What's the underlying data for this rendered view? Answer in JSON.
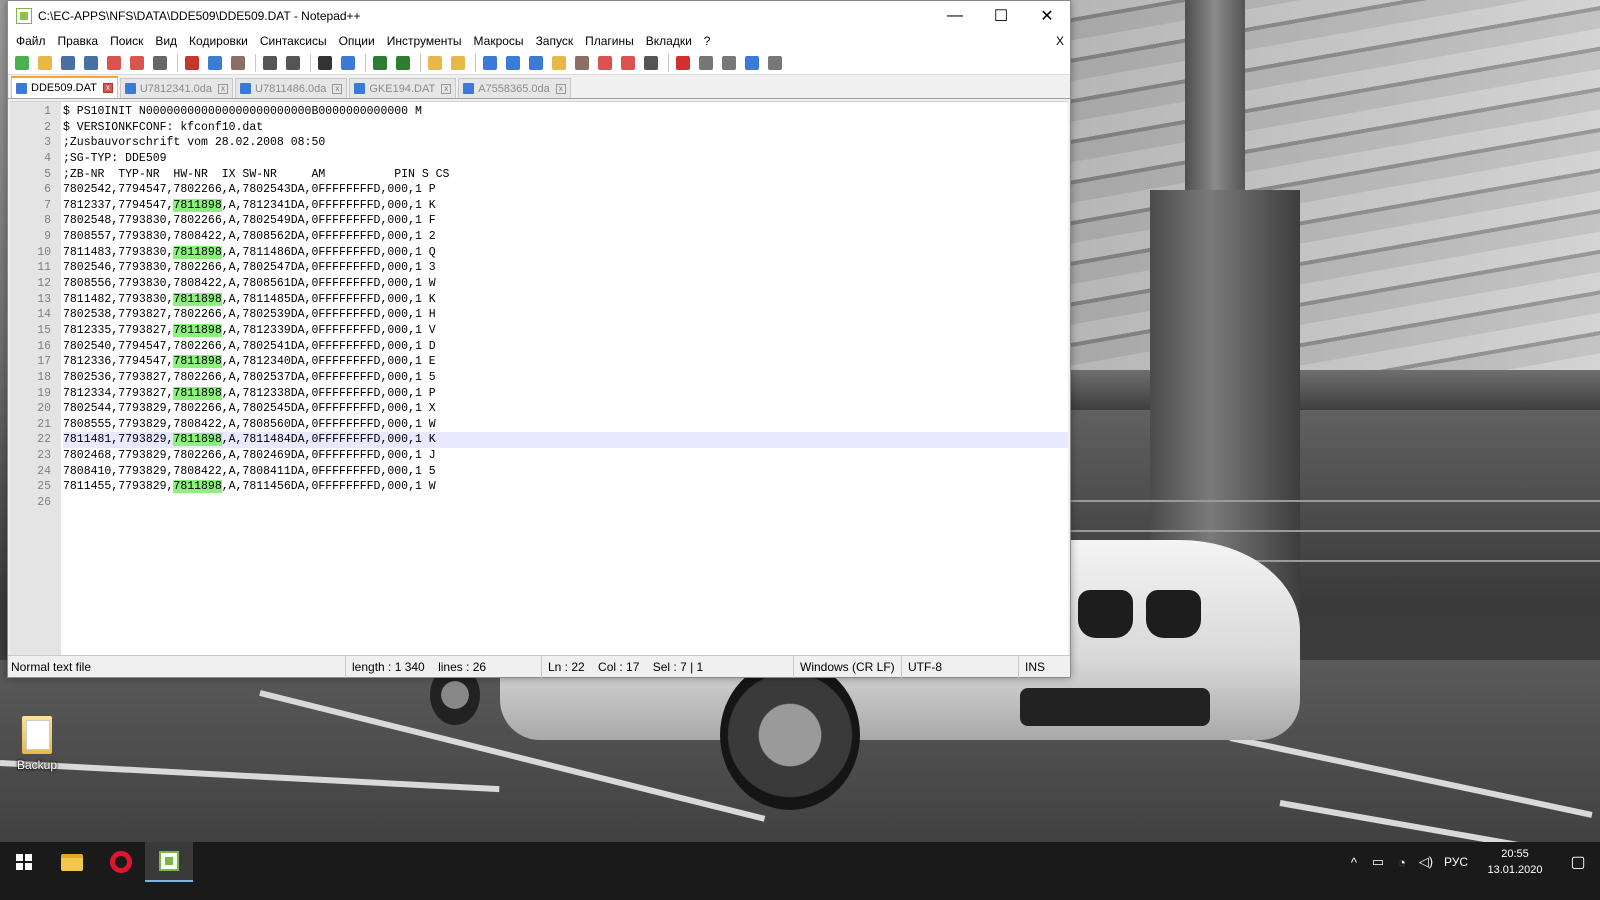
{
  "window": {
    "title": "C:\\EC-APPS\\NFS\\DATA\\DDE509\\DDE509.DAT - Notepad++",
    "minimize_glyph": "—",
    "maximize_glyph": "☐",
    "close_glyph": "✕"
  },
  "menu": [
    "Файл",
    "Правка",
    "Поиск",
    "Вид",
    "Кодировки",
    "Синтаксисы",
    "Опции",
    "Инструменты",
    "Макросы",
    "Запуск",
    "Плагины",
    "Вкладки",
    "?"
  ],
  "menu_close": "X",
  "toolbar": [
    {
      "name": "new-file-icon",
      "color": "#4caf50"
    },
    {
      "name": "open-file-icon",
      "color": "#e6b84a"
    },
    {
      "name": "save-icon",
      "color": "#4a6fa5"
    },
    {
      "name": "save-all-icon",
      "color": "#4a6fa5"
    },
    {
      "name": "close-file-icon",
      "color": "#d9534f"
    },
    {
      "name": "close-all-icon",
      "color": "#d9534f"
    },
    {
      "name": "print-icon",
      "color": "#666666"
    },
    {
      "name": "cut-icon",
      "color": "#c0392b"
    },
    {
      "name": "copy-icon",
      "color": "#3b7bd6"
    },
    {
      "name": "paste-icon",
      "color": "#8d6e63"
    },
    {
      "name": "undo-icon",
      "color": "#555555"
    },
    {
      "name": "redo-icon",
      "color": "#555555"
    },
    {
      "name": "find-icon",
      "color": "#333333"
    },
    {
      "name": "replace-icon",
      "color": "#3b7bd6"
    },
    {
      "name": "zoom-in-icon",
      "color": "#2e7d32"
    },
    {
      "name": "zoom-out-icon",
      "color": "#2e7d32"
    },
    {
      "name": "sync-vertical-icon",
      "color": "#e6b84a"
    },
    {
      "name": "sync-horizontal-icon",
      "color": "#e6b84a"
    },
    {
      "name": "word-wrap-icon",
      "color": "#3b7bd6"
    },
    {
      "name": "show-all-chars-icon",
      "color": "#3b7bd6"
    },
    {
      "name": "indent-guide-icon",
      "color": "#3b7bd6"
    },
    {
      "name": "user-language-icon",
      "color": "#e6b84a"
    },
    {
      "name": "document-map-icon",
      "color": "#8d6e63"
    },
    {
      "name": "function-list-icon",
      "color": "#d9534f"
    },
    {
      "name": "folder-workspace-icon",
      "color": "#d9534f"
    },
    {
      "name": "monitoring-icon",
      "color": "#555555"
    },
    {
      "name": "record-macro-icon",
      "color": "#d32f2f"
    },
    {
      "name": "stop-macro-icon",
      "color": "#777777"
    },
    {
      "name": "play-macro-icon",
      "color": "#777777"
    },
    {
      "name": "run-macro-multiple-icon",
      "color": "#3b7bd6"
    },
    {
      "name": "save-macro-icon",
      "color": "#777777"
    }
  ],
  "tabs": [
    {
      "label": "DDE509.DAT",
      "active": true
    },
    {
      "label": "U7812341.0da",
      "active": false
    },
    {
      "label": "U7811486.0da",
      "active": false
    },
    {
      "label": "GKE194.DAT",
      "active": false
    },
    {
      "label": "A7558365.0da",
      "active": false
    }
  ],
  "editor": {
    "current_line": 22,
    "highlight_term": "7811898",
    "lines": [
      "$ PS10INIT N000000000000000000000000B0000000000000 M",
      "$ VERSIONKFCONF: kfconf10.dat",
      ";Zusbauvorschrift vom 28.02.2008 08:50",
      ";SG-TYP: DDE509",
      ";ZB-NR  TYP-NR  HW-NR  IX SW-NR     AM          PIN S CS",
      "7802542,7794547,7802266,A,7802543DA,0FFFFFFFFD,000,1 P",
      "7812337,7794547,7811898,A,7812341DA,0FFFFFFFFD,000,1 K",
      "7802548,7793830,7802266,A,7802549DA,0FFFFFFFFD,000,1 F",
      "7808557,7793830,7808422,A,7808562DA,0FFFFFFFFD,000,1 2",
      "7811483,7793830,7811898,A,7811486DA,0FFFFFFFFD,000,1 Q",
      "7802546,7793830,7802266,A,7802547DA,0FFFFFFFFD,000,1 3",
      "7808556,7793830,7808422,A,7808561DA,0FFFFFFFFD,000,1 W",
      "7811482,7793830,7811898,A,7811485DA,0FFFFFFFFD,000,1 K",
      "7802538,7793827,7802266,A,7802539DA,0FFFFFFFFD,000,1 H",
      "7812335,7793827,7811898,A,7812339DA,0FFFFFFFFD,000,1 V",
      "7802540,7794547,7802266,A,7802541DA,0FFFFFFFFD,000,1 D",
      "7812336,7794547,7811898,A,7812340DA,0FFFFFFFFD,000,1 E",
      "7802536,7793827,7802266,A,7802537DA,0FFFFFFFFD,000,1 5",
      "7812334,7793827,7811898,A,7812338DA,0FFFFFFFFD,000,1 P",
      "7802544,7793829,7802266,A,7802545DA,0FFFFFFFFD,000,1 X",
      "7808555,7793829,7808422,A,7808560DA,0FFFFFFFFD,000,1 W",
      "7811481,7793829,7811898,A,7811484DA,0FFFFFFFFD,000,1 K",
      "7802468,7793829,7802266,A,7802469DA,0FFFFFFFFD,000,1 J",
      "7808410,7793829,7808422,A,7808411DA,0FFFFFFFFD,000,1 5",
      "7811455,7793829,7811898,A,7811456DA,0FFFFFFFFD,000,1 W",
      ""
    ]
  },
  "statusbar": {
    "file_type": "Normal text file",
    "length": "length : 1 340    lines : 26",
    "position": "Ln : 22    Col : 17    Sel : 7 | 1",
    "eol": "Windows (CR LF)",
    "encoding": "UTF-8",
    "mode": "INS"
  },
  "desktop": {
    "icons": [
      {
        "label": "Backup",
        "icon": "folder-icon"
      }
    ]
  },
  "taskbar": {
    "apps": [
      {
        "name": "start-button",
        "icon": "windows-logo-icon"
      },
      {
        "name": "file-explorer",
        "icon": "folder-icon"
      },
      {
        "name": "opera",
        "icon": "opera-icon"
      },
      {
        "name": "notepad-plus-plus",
        "icon": "notepad-plus-plus-icon",
        "active": true
      }
    ],
    "tray": {
      "chevron": "^",
      "language": "РУС",
      "time": "20:55",
      "date": "13.01.2020"
    }
  },
  "colors": {
    "highlight": "#8bf27c",
    "current_line": "#e8e8ff",
    "active_tab_accent": "#f5a623",
    "opera_red": "#e0162b"
  }
}
